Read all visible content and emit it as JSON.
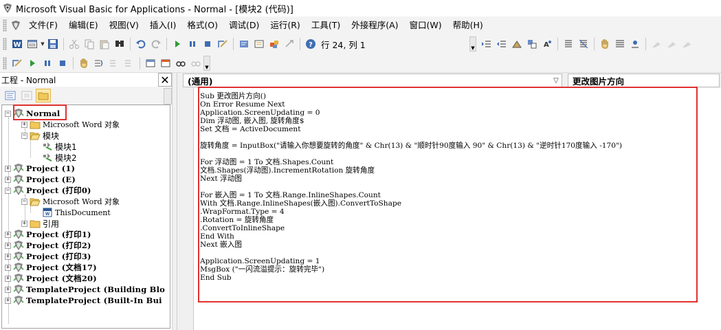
{
  "window": {
    "title": "Microsoft Visual Basic for Applications - Normal - [模块2 (代码)]"
  },
  "menu": {
    "items": [
      {
        "label": "文件(F)"
      },
      {
        "label": "编辑(E)"
      },
      {
        "label": "视图(V)"
      },
      {
        "label": "插入(I)"
      },
      {
        "label": "格式(O)"
      },
      {
        "label": "调试(D)"
      },
      {
        "label": "运行(R)"
      },
      {
        "label": "工具(T)"
      },
      {
        "label": "外接程序(A)"
      },
      {
        "label": "窗口(W)"
      },
      {
        "label": "帮助(H)"
      }
    ]
  },
  "toolbar": {
    "position_label": "行 24, 列 1"
  },
  "project_pane": {
    "title": "工程 - Normal",
    "close_glyph": "✕",
    "tree": [
      {
        "label": "Normal",
        "level": 0,
        "expander": "−",
        "icon": "vba-project-icon",
        "style": "bold"
      },
      {
        "label": "Microsoft Word 对象",
        "level": 1,
        "expander": "+",
        "icon": "folder-icon",
        "style": "normal"
      },
      {
        "label": "模块",
        "level": 1,
        "expander": "−",
        "icon": "folder-open-icon",
        "style": "normal"
      },
      {
        "label": "模块1",
        "level": 2,
        "expander": "",
        "icon": "module-icon",
        "style": "normal"
      },
      {
        "label": "模块2",
        "level": 2,
        "expander": "",
        "icon": "module-icon",
        "style": "normal"
      },
      {
        "label": "Project (1)",
        "level": 0,
        "expander": "+",
        "icon": "vba-project-icon",
        "style": "bold"
      },
      {
        "label": "Project (E)",
        "level": 0,
        "expander": "+",
        "icon": "vba-project-icon",
        "style": "bold"
      },
      {
        "label": "Project (打印0)",
        "level": 0,
        "expander": "−",
        "icon": "vba-project-icon",
        "style": "bold"
      },
      {
        "label": "Microsoft Word 对象",
        "level": 1,
        "expander": "−",
        "icon": "folder-open-icon",
        "style": "normal"
      },
      {
        "label": "ThisDocument",
        "level": 2,
        "expander": "",
        "icon": "document-icon",
        "style": "mono"
      },
      {
        "label": "引用",
        "level": 1,
        "expander": "+",
        "icon": "folder-icon",
        "style": "normal"
      },
      {
        "label": "Project (打印1)",
        "level": 0,
        "expander": "+",
        "icon": "vba-project-icon",
        "style": "bold"
      },
      {
        "label": "Project (打印2)",
        "level": 0,
        "expander": "+",
        "icon": "vba-project-icon",
        "style": "bold"
      },
      {
        "label": "Project (打印3)",
        "level": 0,
        "expander": "+",
        "icon": "vba-project-icon",
        "style": "bold"
      },
      {
        "label": "Project (文档17)",
        "level": 0,
        "expander": "+",
        "icon": "vba-project-icon",
        "style": "bold"
      },
      {
        "label": "Project (文档20)",
        "level": 0,
        "expander": "+",
        "icon": "vba-project-icon",
        "style": "bold"
      },
      {
        "label": "TemplateProject (Building Blo",
        "level": 0,
        "expander": "+",
        "icon": "vba-project-icon",
        "style": "bold"
      },
      {
        "label": "TemplateProject (Built-In Bui",
        "level": 0,
        "expander": "+",
        "icon": "vba-project-icon",
        "style": "bold"
      }
    ]
  },
  "code_window": {
    "object_combo": "(通用)",
    "procedure_combo": "更改图片方向",
    "lines": [
      "Sub 更改图片方向()",
      "On Error Resume Next",
      "Application.ScreenUpdating = 0",
      "Dim 浮动图, 嵌入图, 旋转角度$",
      "Set 文档 = ActiveDocument",
      "",
      "旋转角度 = InputBox(\"请输入你想要旋转的角度\" & Chr(13) & \"顺时针90度输入 90\" & Chr(13) & \"逆时针170度输入 -170\")",
      "",
      "For 浮动图 = 1 To 文档.Shapes.Count",
      "文档.Shapes(浮动图).IncrementRotation 旋转角度",
      "Next 浮动图",
      "",
      "For 嵌入图 = 1 To 文档.Range.InlineShapes.Count",
      "With 文档.Range.InlineShapes(嵌入图).ConvertToShape",
      ".WrapFormat.Type = 4",
      ".Rotation = 旋转角度",
      ".ConvertToInlineShape",
      "End With",
      "Next 嵌入图",
      "",
      "Application.ScreenUpdating = 1",
      "MsgBox (\"一闪流溢提示：旋转完毕\")",
      "End Sub"
    ]
  },
  "colors": {
    "highlight_box": "#e03030",
    "chrome_bg": "#f3f3f3"
  }
}
